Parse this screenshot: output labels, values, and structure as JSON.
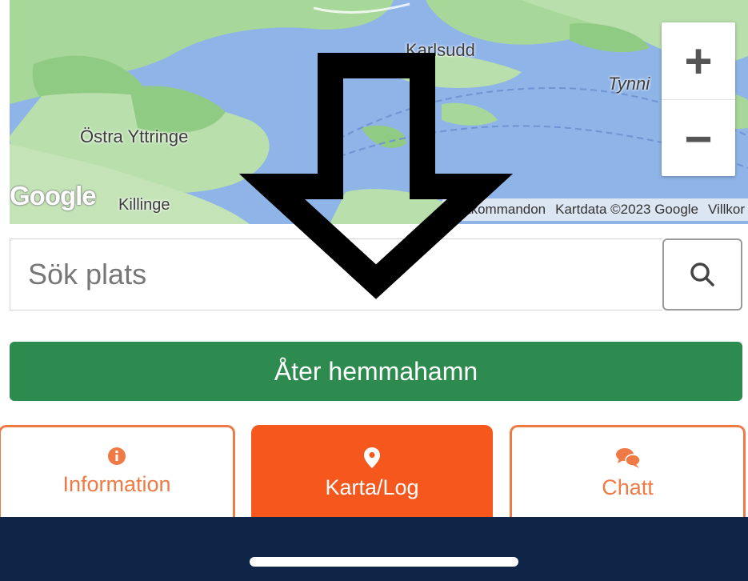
{
  "map": {
    "labels": {
      "karlsudd": "Karlsudd",
      "tynn": "Tynni",
      "ostra": "Östra Yttringe",
      "killinge": "Killinge"
    },
    "google_logo": "Google",
    "shortcuts": "Kortkommandon",
    "copyright": "Kartdata ©2023 Google",
    "terms": "Villkor",
    "zoom_in": "+",
    "zoom_out": "−",
    "colors": {
      "water": "#8fb4e8",
      "land": "#a8d79a",
      "forest": "#7ec27a"
    }
  },
  "search": {
    "placeholder": "Sök plats",
    "button_icon": "search-icon"
  },
  "home_button": {
    "label": "Åter hemmahamn",
    "color": "#2e8b4f"
  },
  "tabs": [
    {
      "label": "Information",
      "icon": "info-icon",
      "active": false
    },
    {
      "label": "Karta/Log",
      "icon": "map-pin-icon",
      "active": true
    },
    {
      "label": "Chatt",
      "icon": "chat-icon",
      "active": false
    }
  ],
  "accent_color": "#f5571c",
  "bottom_bar": {
    "color": "#0f2548"
  },
  "overlay": {
    "icon": "down-arrow-outline-icon"
  }
}
